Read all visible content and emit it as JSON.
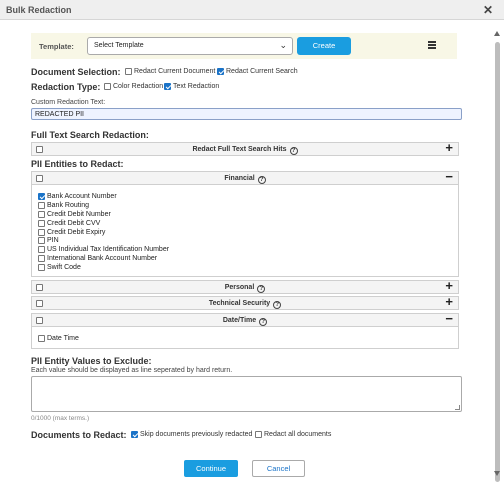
{
  "window": {
    "title": "Bulk Redaction"
  },
  "template": {
    "label": "Template:",
    "selected": "Select Template",
    "create_label": "Create"
  },
  "document_selection": {
    "label": "Document Selection:",
    "options": [
      {
        "label": "Redact Current Document",
        "checked": false
      },
      {
        "label": "Redact Current Search",
        "checked": true
      }
    ]
  },
  "redaction_type": {
    "label": "Redaction Type:",
    "options": [
      {
        "label": "Color Redaction",
        "checked": false
      },
      {
        "label": "Text Redaction",
        "checked": true
      }
    ]
  },
  "custom_text": {
    "label": "Custom Redaction Text:",
    "value": "REDACTED PII"
  },
  "full_text_search": {
    "label": "Full Text Search Redaction:",
    "panel_title": "Redact Full Text Search Hits",
    "checked": false,
    "toggle": "+"
  },
  "pii_entities": {
    "label": "PII Entities to Redact:",
    "groups": [
      {
        "title": "Financial",
        "checked": false,
        "toggle": "−",
        "items": [
          {
            "label": "Bank Account Number",
            "checked": true
          },
          {
            "label": "Bank Routing",
            "checked": false
          },
          {
            "label": "Credit Debit Number",
            "checked": false
          },
          {
            "label": "Credit Debit CVV",
            "checked": false
          },
          {
            "label": "Credit Debit Expiry",
            "checked": false
          },
          {
            "label": "PIN",
            "checked": false
          },
          {
            "label": "US Individual Tax Identification Number",
            "checked": false
          },
          {
            "label": "International Bank Account Number",
            "checked": false
          },
          {
            "label": "Swift Code",
            "checked": false
          }
        ]
      },
      {
        "title": "Personal",
        "checked": false,
        "toggle": "+"
      },
      {
        "title": "Technical Security",
        "checked": false,
        "toggle": "+"
      },
      {
        "title": "Date/Time",
        "checked": false,
        "toggle": "−",
        "items": [
          {
            "label": "Date Time",
            "checked": false
          }
        ]
      }
    ]
  },
  "exclude": {
    "label": "PII Entity Values to Exclude:",
    "hint": "Each value should be displayed as line seperated by hard return.",
    "value": "",
    "counter": "0/1000 (max terms.)"
  },
  "documents_to_redact": {
    "label": "Documents to Redact:",
    "options": [
      {
        "label": "Skip documents previously redacted",
        "checked": true
      },
      {
        "label": "Redact all documents",
        "checked": false
      }
    ]
  },
  "actions": {
    "continue_label": "Continue",
    "cancel_label": "Cancel"
  },
  "colors": {
    "accent": "#1a9de0",
    "checkbox": "#1a73c8",
    "template_bar": "#f8f7e6"
  }
}
